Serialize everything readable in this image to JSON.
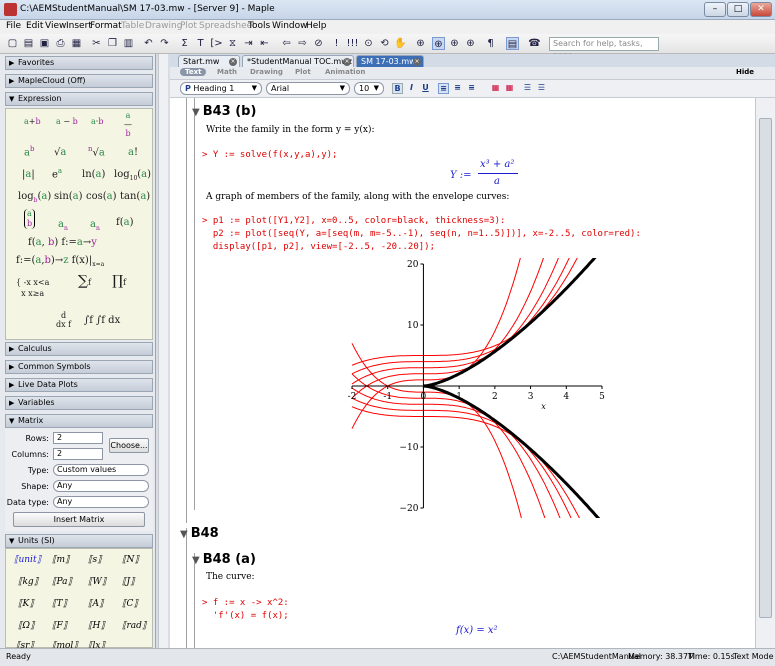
{
  "window": {
    "title": "C:\\AEMStudentManual\\SM 17-03.mw - [Server 9] - Maple"
  },
  "menu": [
    "File",
    "Edit",
    "View",
    "Insert",
    "Format",
    "Table",
    "Drawing",
    "Plot",
    "Spreadsheet",
    "Tools",
    "Window",
    "Help"
  ],
  "menu_disabled": [
    "Table",
    "Drawing",
    "Plot",
    "Spreadsheet"
  ],
  "search": {
    "placeholder": "Search for help, tasks, apps..."
  },
  "palette": {
    "sections": {
      "favorites": "Favorites",
      "maplecloud": "MapleCloud (Off)",
      "expression": "Expression",
      "calculus": "Calculus",
      "common_symbols": "Common Symbols",
      "live_data_plots": "Live Data Plots",
      "variables": "Variables",
      "matrix": "Matrix",
      "units": "Units (SI)"
    },
    "matrix": {
      "rows_label": "Rows:",
      "rows_value": "2",
      "cols_label": "Columns:",
      "cols_value": "2",
      "choose": "Choose...",
      "type_label": "Type:",
      "type_value": "Custom values",
      "shape_label": "Shape:",
      "shape_value": "Any",
      "dtype_label": "Data type:",
      "dtype_value": "Any",
      "insert": "Insert Matrix"
    },
    "units": [
      "unit",
      "m",
      "s",
      "N",
      "kg",
      "Pa",
      "W",
      "J",
      "K",
      "T",
      "A",
      "C",
      "Ω",
      "F",
      "H",
      "rad",
      "sr",
      "mol",
      "lx"
    ]
  },
  "tabs": [
    {
      "label": "Start.mw"
    },
    {
      "label": "*StudentManual TOC.mwz"
    },
    {
      "label": "SM 17-03.mw"
    }
  ],
  "modes": [
    "Text",
    "Math",
    "Drawing",
    "Plot",
    "Animation"
  ],
  "hide": "Hide",
  "format": {
    "style": "Heading 1",
    "font": "Arial",
    "size": "10"
  },
  "doc": {
    "b43b": "B43 (b)",
    "b43b_text": "Write the family in the form y = y(x):",
    "input1": "> Y := solve(f(x,y,a),y);",
    "output1_lhs": "Y :=",
    "output1_num": "x³ + a²",
    "output1_den": "a",
    "text2": "A graph of members of the family, along with the envelope curves:",
    "input2_l1": "> p1 := plot([Y1,Y2], x=0..5, color=black, thickness=3):",
    "input2_l2": "  p2 := plot([seq(Y, a=[seq(m, m=-5..-1), seq(n, n=1..5)])], x=-2..5, color=red):",
    "input2_l3": "  display([p1, p2], view=[-2..5, -20..20]);",
    "b48": "B48",
    "b48a": "B48 (a)",
    "curve_text": "The curve:",
    "input3_l1": "> f := x -> x^2:",
    "input3_l2": "  'f'(x) = f(x);",
    "output3": "f(x) = x²"
  },
  "chart_data": {
    "type": "line",
    "xlim": [
      -2,
      5
    ],
    "ylim": [
      -20,
      20
    ],
    "xticks": [
      "-2",
      "-1",
      "0",
      "1",
      "2",
      "3",
      "4",
      "5"
    ],
    "yticks": [
      "20",
      "10",
      "-10",
      "-20"
    ],
    "xlabel": "x",
    "ylabel": "",
    "grid": false,
    "series": [
      {
        "color": "#000000",
        "thickness": 3,
        "expr": "Y1 = +(x^3)^(1/2)... envelope (upper)",
        "a": "env+"
      },
      {
        "color": "#000000",
        "thickness": 3,
        "expr": "envelope (lower)",
        "a": "env-"
      },
      {
        "color": "#ff0000",
        "a": [
          -5,
          -4,
          -3,
          -2,
          -1,
          1,
          2,
          3,
          4,
          5
        ],
        "expr": "(x^3 + a^2)/a"
      }
    ]
  },
  "status": {
    "ready": "Ready",
    "path": "C:\\AEMStudentManual",
    "memory": "Memory: 38.37M",
    "time": "Time: 0.15s",
    "mode": "Text Mode"
  }
}
